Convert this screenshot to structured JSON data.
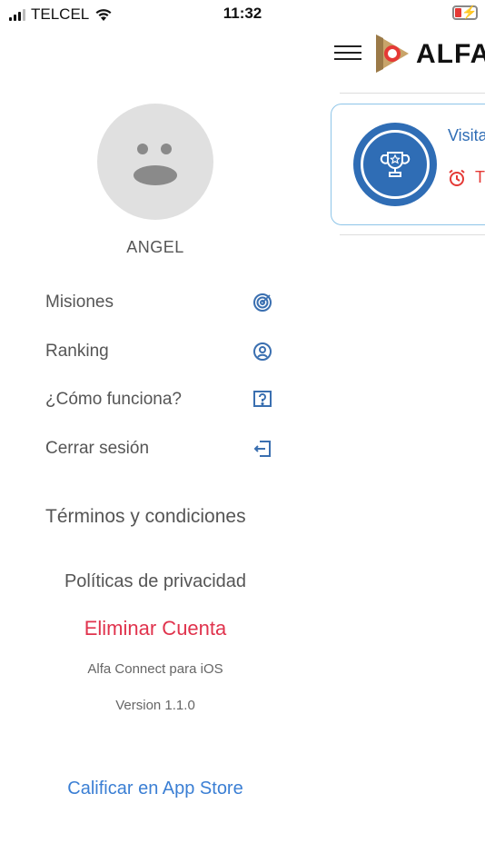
{
  "status_bar": {
    "carrier": "TELCEL",
    "time": "11:32",
    "battery_color": "#e53935"
  },
  "drawer": {
    "user_name": "ANGEL",
    "menu": [
      {
        "label": "Misiones",
        "icon": "target-icon"
      },
      {
        "label": "Ranking",
        "icon": "user-circle-icon"
      },
      {
        "label": "¿Cómo funciona?",
        "icon": "question-box-icon"
      },
      {
        "label": "Cerrar sesión",
        "icon": "logout-icon"
      }
    ],
    "terms_label": "Términos y condiciones",
    "privacy_label": "Políticas de privacidad",
    "delete_account_label": "Eliminar Cuenta",
    "app_name": "Alfa Connect para iOS",
    "version": "Version 1.1.0",
    "rate_label": "Calificar en App Store"
  },
  "background_page": {
    "logo_text": "ALFA",
    "card": {
      "title": "Visita",
      "subtitle": "T",
      "icon": "trophy-icon"
    }
  },
  "colors": {
    "accent_blue": "#2f6db5",
    "delete_red": "#e0334d",
    "link_blue": "#3b7fd4",
    "icon_blue": "#3a6fb0"
  }
}
